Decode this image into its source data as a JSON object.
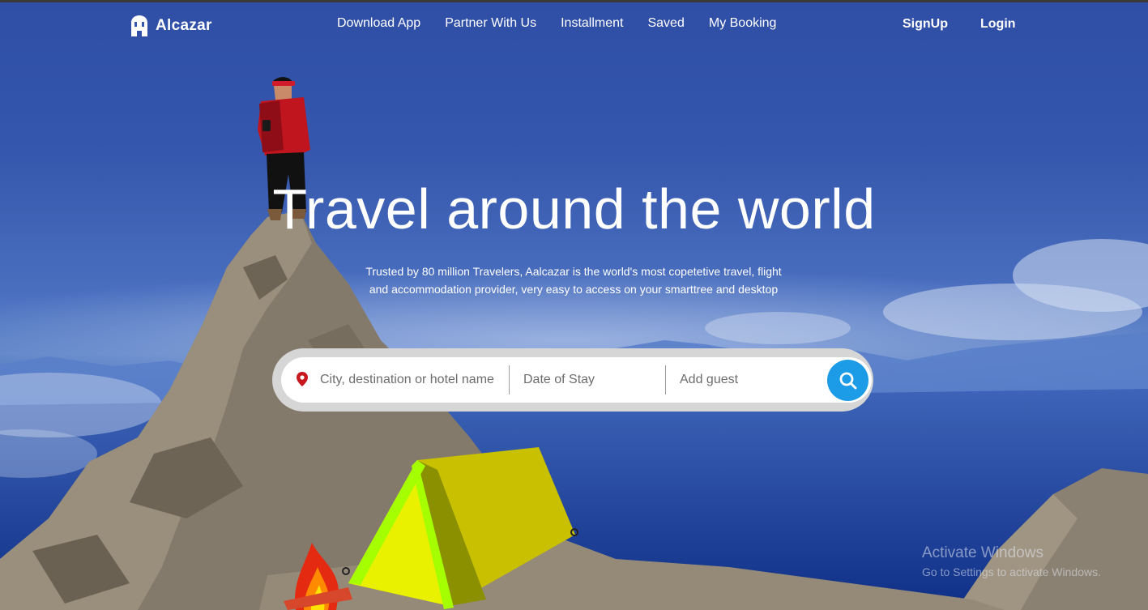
{
  "header": {
    "logo_text": "Alcazar",
    "nav": [
      {
        "label": "Download App"
      },
      {
        "label": "Partner With Us"
      },
      {
        "label": "Installment"
      },
      {
        "label": "Saved"
      },
      {
        "label": "My Booking"
      }
    ],
    "auth": {
      "signup": "SignUp",
      "login": "Login"
    }
  },
  "hero": {
    "title": "Travel around the world",
    "subtitle_line1": "Trusted by 80 million Travelers, Aalcazar is the world's most copetetive travel, flight",
    "subtitle_line2": "and accommodation provider, very easy to access on your smarttree and desktop"
  },
  "search": {
    "destination_placeholder": "City, destination or hotel name",
    "date_placeholder": "Date of Stay",
    "guest_placeholder": "Add guest",
    "location_icon": "map-pin-icon",
    "search_icon": "magnifier-icon",
    "accent_color": "#1c9be6",
    "pin_color": "#c8171e"
  },
  "watermark": {
    "title": "Activate Windows",
    "subtitle": "Go to Settings to activate Windows."
  }
}
